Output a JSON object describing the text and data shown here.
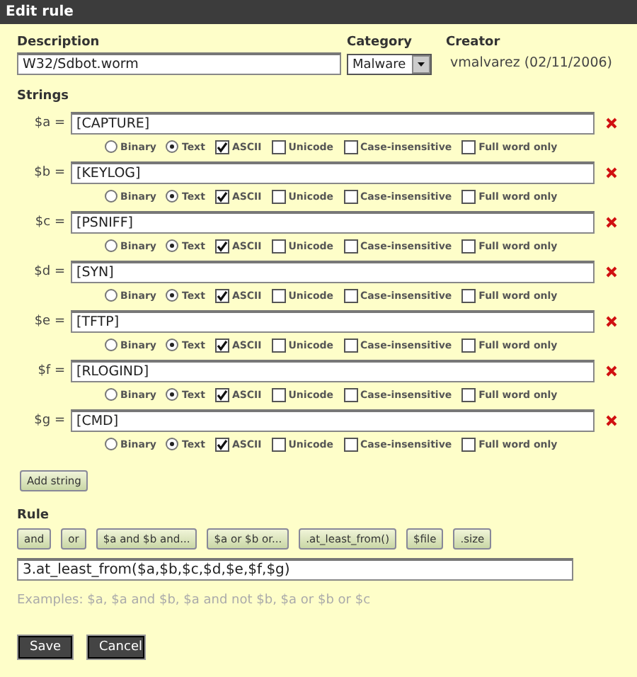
{
  "window": {
    "title": "Edit rule"
  },
  "description": {
    "label": "Description",
    "value": "W32/Sdbot.worm"
  },
  "category": {
    "label": "Category",
    "value": "Malware"
  },
  "creator": {
    "label": "Creator",
    "value": "vmalvarez (02/11/2006)"
  },
  "strings_label": "Strings",
  "strings": [
    {
      "var": "$a =",
      "value": "[CAPTURE]",
      "options": [
        {
          "kind": "radio",
          "label": "Binary",
          "selected": false
        },
        {
          "kind": "radio",
          "label": "Text",
          "selected": true
        },
        {
          "kind": "checkbox",
          "label": "ASCII",
          "checked": true
        },
        {
          "kind": "checkbox",
          "label": "Unicode",
          "checked": false
        },
        {
          "kind": "checkbox",
          "label": "Case-insensitive",
          "checked": false
        },
        {
          "kind": "checkbox",
          "label": "Full word only",
          "checked": false
        }
      ]
    },
    {
      "var": "$b =",
      "value": "[KEYLOG]",
      "options": [
        {
          "kind": "radio",
          "label": "Binary",
          "selected": false
        },
        {
          "kind": "radio",
          "label": "Text",
          "selected": true
        },
        {
          "kind": "checkbox",
          "label": "ASCII",
          "checked": true
        },
        {
          "kind": "checkbox",
          "label": "Unicode",
          "checked": false
        },
        {
          "kind": "checkbox",
          "label": "Case-insensitive",
          "checked": false
        },
        {
          "kind": "checkbox",
          "label": "Full word only",
          "checked": false
        }
      ]
    },
    {
      "var": "$c =",
      "value": "[PSNIFF]",
      "options": [
        {
          "kind": "radio",
          "label": "Binary",
          "selected": false
        },
        {
          "kind": "radio",
          "label": "Text",
          "selected": true
        },
        {
          "kind": "checkbox",
          "label": "ASCII",
          "checked": true
        },
        {
          "kind": "checkbox",
          "label": "Unicode",
          "checked": false
        },
        {
          "kind": "checkbox",
          "label": "Case-insensitive",
          "checked": false
        },
        {
          "kind": "checkbox",
          "label": "Full word only",
          "checked": false
        }
      ]
    },
    {
      "var": "$d =",
      "value": "[SYN]",
      "options": [
        {
          "kind": "radio",
          "label": "Binary",
          "selected": false
        },
        {
          "kind": "radio",
          "label": "Text",
          "selected": true
        },
        {
          "kind": "checkbox",
          "label": "ASCII",
          "checked": true
        },
        {
          "kind": "checkbox",
          "label": "Unicode",
          "checked": false
        },
        {
          "kind": "checkbox",
          "label": "Case-insensitive",
          "checked": false
        },
        {
          "kind": "checkbox",
          "label": "Full word only",
          "checked": false
        }
      ]
    },
    {
      "var": "$e =",
      "value": "[TFTP]",
      "options": [
        {
          "kind": "radio",
          "label": "Binary",
          "selected": false
        },
        {
          "kind": "radio",
          "label": "Text",
          "selected": true
        },
        {
          "kind": "checkbox",
          "label": "ASCII",
          "checked": true
        },
        {
          "kind": "checkbox",
          "label": "Unicode",
          "checked": false
        },
        {
          "kind": "checkbox",
          "label": "Case-insensitive",
          "checked": false
        },
        {
          "kind": "checkbox",
          "label": "Full word only",
          "checked": false
        }
      ]
    },
    {
      "var": "$f =",
      "value": "[RLOGIND]",
      "options": [
        {
          "kind": "radio",
          "label": "Binary",
          "selected": false
        },
        {
          "kind": "radio",
          "label": "Text",
          "selected": true
        },
        {
          "kind": "checkbox",
          "label": "ASCII",
          "checked": true
        },
        {
          "kind": "checkbox",
          "label": "Unicode",
          "checked": false
        },
        {
          "kind": "checkbox",
          "label": "Case-insensitive",
          "checked": false
        },
        {
          "kind": "checkbox",
          "label": "Full word only",
          "checked": false
        }
      ]
    },
    {
      "var": "$g =",
      "value": "[CMD]",
      "options": [
        {
          "kind": "radio",
          "label": "Binary",
          "selected": false
        },
        {
          "kind": "radio",
          "label": "Text",
          "selected": true
        },
        {
          "kind": "checkbox",
          "label": "ASCII",
          "checked": true
        },
        {
          "kind": "checkbox",
          "label": "Unicode",
          "checked": false
        },
        {
          "kind": "checkbox",
          "label": "Case-insensitive",
          "checked": false
        },
        {
          "kind": "checkbox",
          "label": "Full word only",
          "checked": false
        }
      ]
    }
  ],
  "add_string_button": "Add string",
  "rule": {
    "label": "Rule",
    "buttons": [
      "and",
      "or",
      "$a and $b and...",
      "$a or $b or...",
      ".at_least_from()",
      "$file",
      ".size"
    ],
    "value": "3.at_least_from($a,$b,$c,$d,$e,$f,$g)",
    "examples": "Examples: $a, $a and $b, $a and not $b, $a or $b or $c"
  },
  "actions": [
    "Save",
    "Cancel"
  ]
}
